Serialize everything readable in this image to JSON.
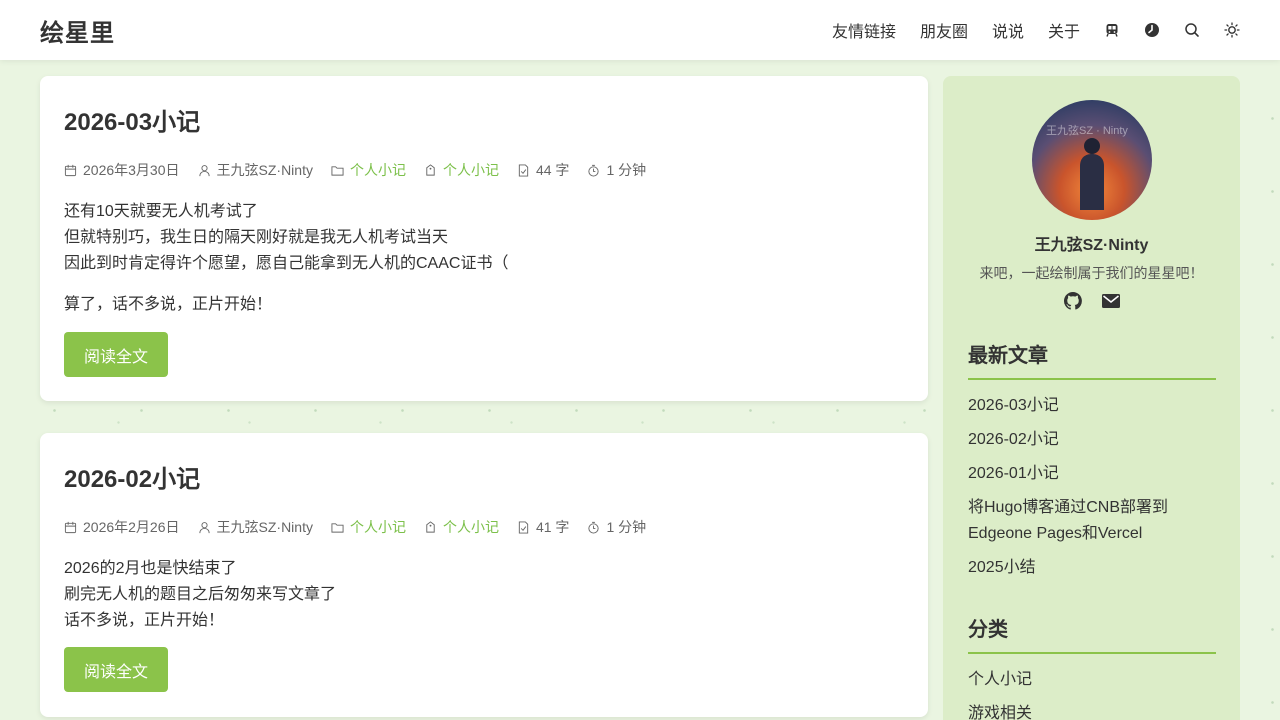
{
  "site": {
    "logo": "绘星里"
  },
  "nav": {
    "links": [
      "友情链接",
      "朋友圈",
      "说说",
      "关于"
    ],
    "icons": [
      "train-icon",
      "clock-icon",
      "search-icon",
      "sun-icon"
    ]
  },
  "posts": [
    {
      "title": "2026-03小记",
      "date": "2026年3月30日",
      "author": "王九弦SZ·Ninty",
      "category": "个人小记",
      "tag": "个人小记",
      "words": "44 字",
      "read_time": "1 分钟",
      "lines": [
        "还有10天就要无人机考试了",
        "但就特别巧，我生日的隔天刚好就是我无人机考试当天",
        "因此到时肯定得许个愿望，愿自己能拿到无人机的CAAC证书（"
      ],
      "extra": "算了，话不多说，正片开始！",
      "button": "阅读全文"
    },
    {
      "title": "2026-02小记",
      "date": "2026年2月26日",
      "author": "王九弦SZ·Ninty",
      "category": "个人小记",
      "tag": "个人小记",
      "words": "41 字",
      "read_time": "1 分钟",
      "lines": [
        "2026的2月也是快结束了",
        "刷完无人机的题目之后匆匆来写文章了",
        "话不多说，正片开始！"
      ],
      "button": "阅读全文"
    }
  ],
  "sidebar": {
    "avatar_watermark": "王九弦SZ · Ninty",
    "author": "王九弦SZ·Ninty",
    "bio": "来吧，一起绘制属于我们的星星吧！",
    "social": [
      "github-icon",
      "mail-icon"
    ],
    "latest_heading": "最新文章",
    "latest": [
      "2026-03小记",
      "2026-02小记",
      "2026-01小记",
      "将Hugo博客通过CNB部署到Edgeone Pages和Vercel",
      "2025小结"
    ],
    "category_heading": "分类",
    "categories": [
      "个人小记",
      "游戏相关"
    ]
  },
  "colors": {
    "accent": "#8bc34a",
    "meta_link": "#7cc04a",
    "sidebar_bg": "#dcedc8",
    "page_bg": "#eaf5e1"
  }
}
